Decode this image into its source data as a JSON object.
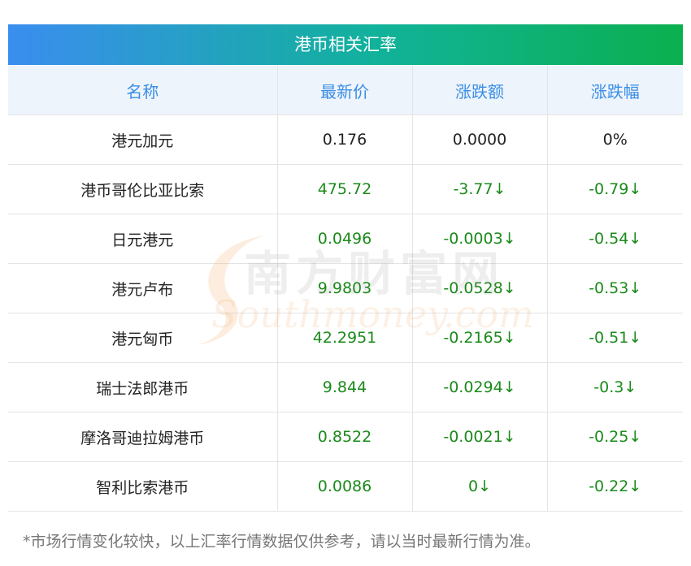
{
  "title": "港币相关汇率",
  "columns": [
    "名称",
    "最新价",
    "涨跌额",
    "涨跌幅"
  ],
  "rows": [
    {
      "name": "港元加元",
      "price": "0.176",
      "change": "0.0000",
      "pct": "0%",
      "trend": "flat"
    },
    {
      "name": "港币哥伦比亚比索",
      "price": "475.72",
      "change": "-3.77↓",
      "pct": "-0.79↓",
      "trend": "down"
    },
    {
      "name": "日元港元",
      "price": "0.0496",
      "change": "-0.0003↓",
      "pct": "-0.54↓",
      "trend": "down"
    },
    {
      "name": "港元卢布",
      "price": "9.9803",
      "change": "-0.0528↓",
      "pct": "-0.53↓",
      "trend": "down"
    },
    {
      "name": "港元匈币",
      "price": "42.2951",
      "change": "-0.2165↓",
      "pct": "-0.51↓",
      "trend": "down"
    },
    {
      "name": "瑞士法郎港币",
      "price": "9.844",
      "change": "-0.0294↓",
      "pct": "-0.3↓",
      "trend": "down"
    },
    {
      "name": "摩洛哥迪拉姆港币",
      "price": "0.8522",
      "change": "-0.0021↓",
      "pct": "-0.25↓",
      "trend": "down"
    },
    {
      "name": "智利比索港币",
      "price": "0.0086",
      "change": "0↓",
      "pct": "-0.22↓",
      "trend": "down"
    }
  ],
  "watermark": {
    "cn": "南方财富网",
    "en": "Southmoney.com"
  },
  "footnote": "*市场行情变化较快，以上汇率行情数据仅供参考，请以当时最新行情为准。",
  "colors": {
    "header_text": "#3a8ee6",
    "down": "#1a8a1a",
    "gradient_start": "#3b8df0",
    "gradient_end": "#0bb04e"
  }
}
